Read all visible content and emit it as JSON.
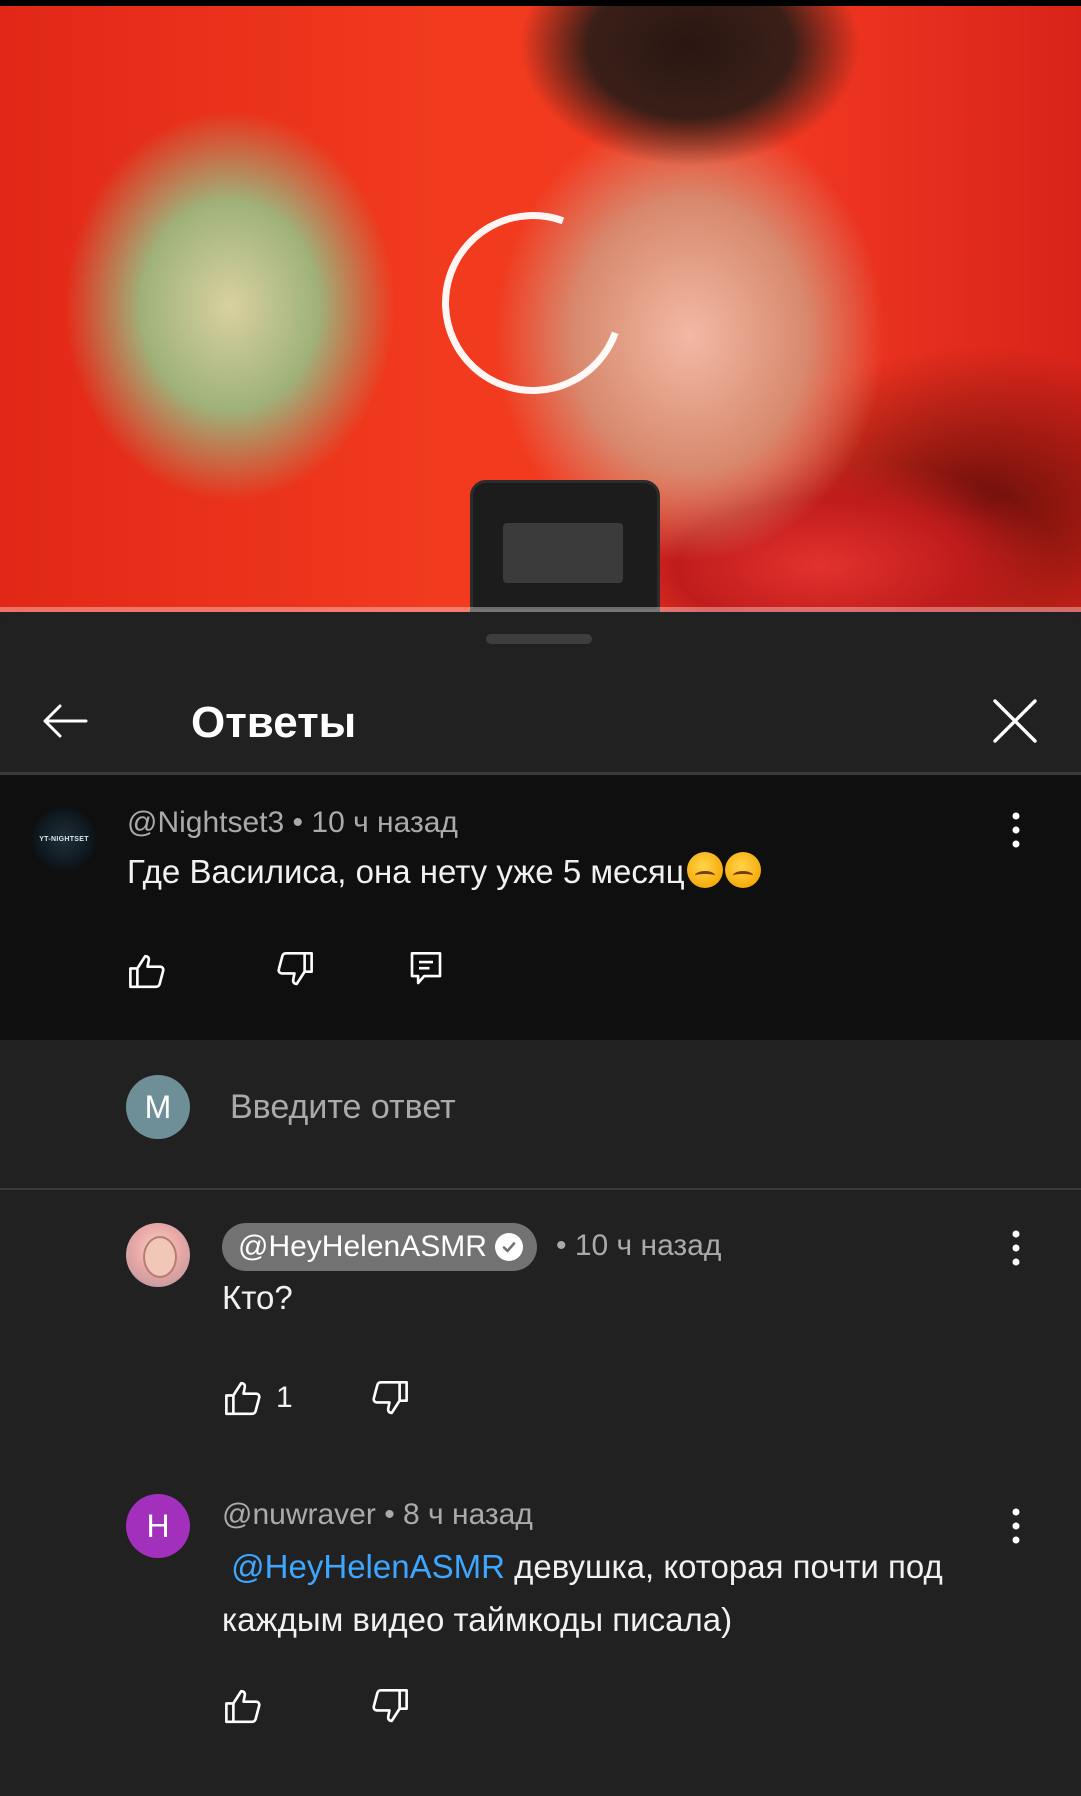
{
  "video": {
    "progress_fraction": 0.0,
    "loading": true
  },
  "panel": {
    "title": "Ответы"
  },
  "parent_comment": {
    "author": "@Nightset3",
    "time": "• 10 ч назад",
    "avatar_text": "YT-NIGHTSET",
    "text": "Где Василиса, она нету уже 5 месяц"
  },
  "reply_input": {
    "avatar_letter": "M",
    "placeholder": "Введите ответ"
  },
  "replies": [
    {
      "author": "@HeyHelenASMR",
      "verified": true,
      "time": "• 10 ч назад",
      "text": "Кто?",
      "likes": "1"
    },
    {
      "author": "@nuwraver",
      "avatar_letter": "H",
      "time": "• 8 ч назад",
      "mention": "@HeyHelenASMR",
      "text": " девушка, которая почти под каждым видео таймкоды писала)",
      "likes": ""
    }
  ],
  "colors": {
    "background": "#212121",
    "parent_background": "#0f0f0f",
    "mention": "#3ea6ff",
    "avatar_m": "#6e8f98",
    "avatar_h": "#a32fbd"
  }
}
